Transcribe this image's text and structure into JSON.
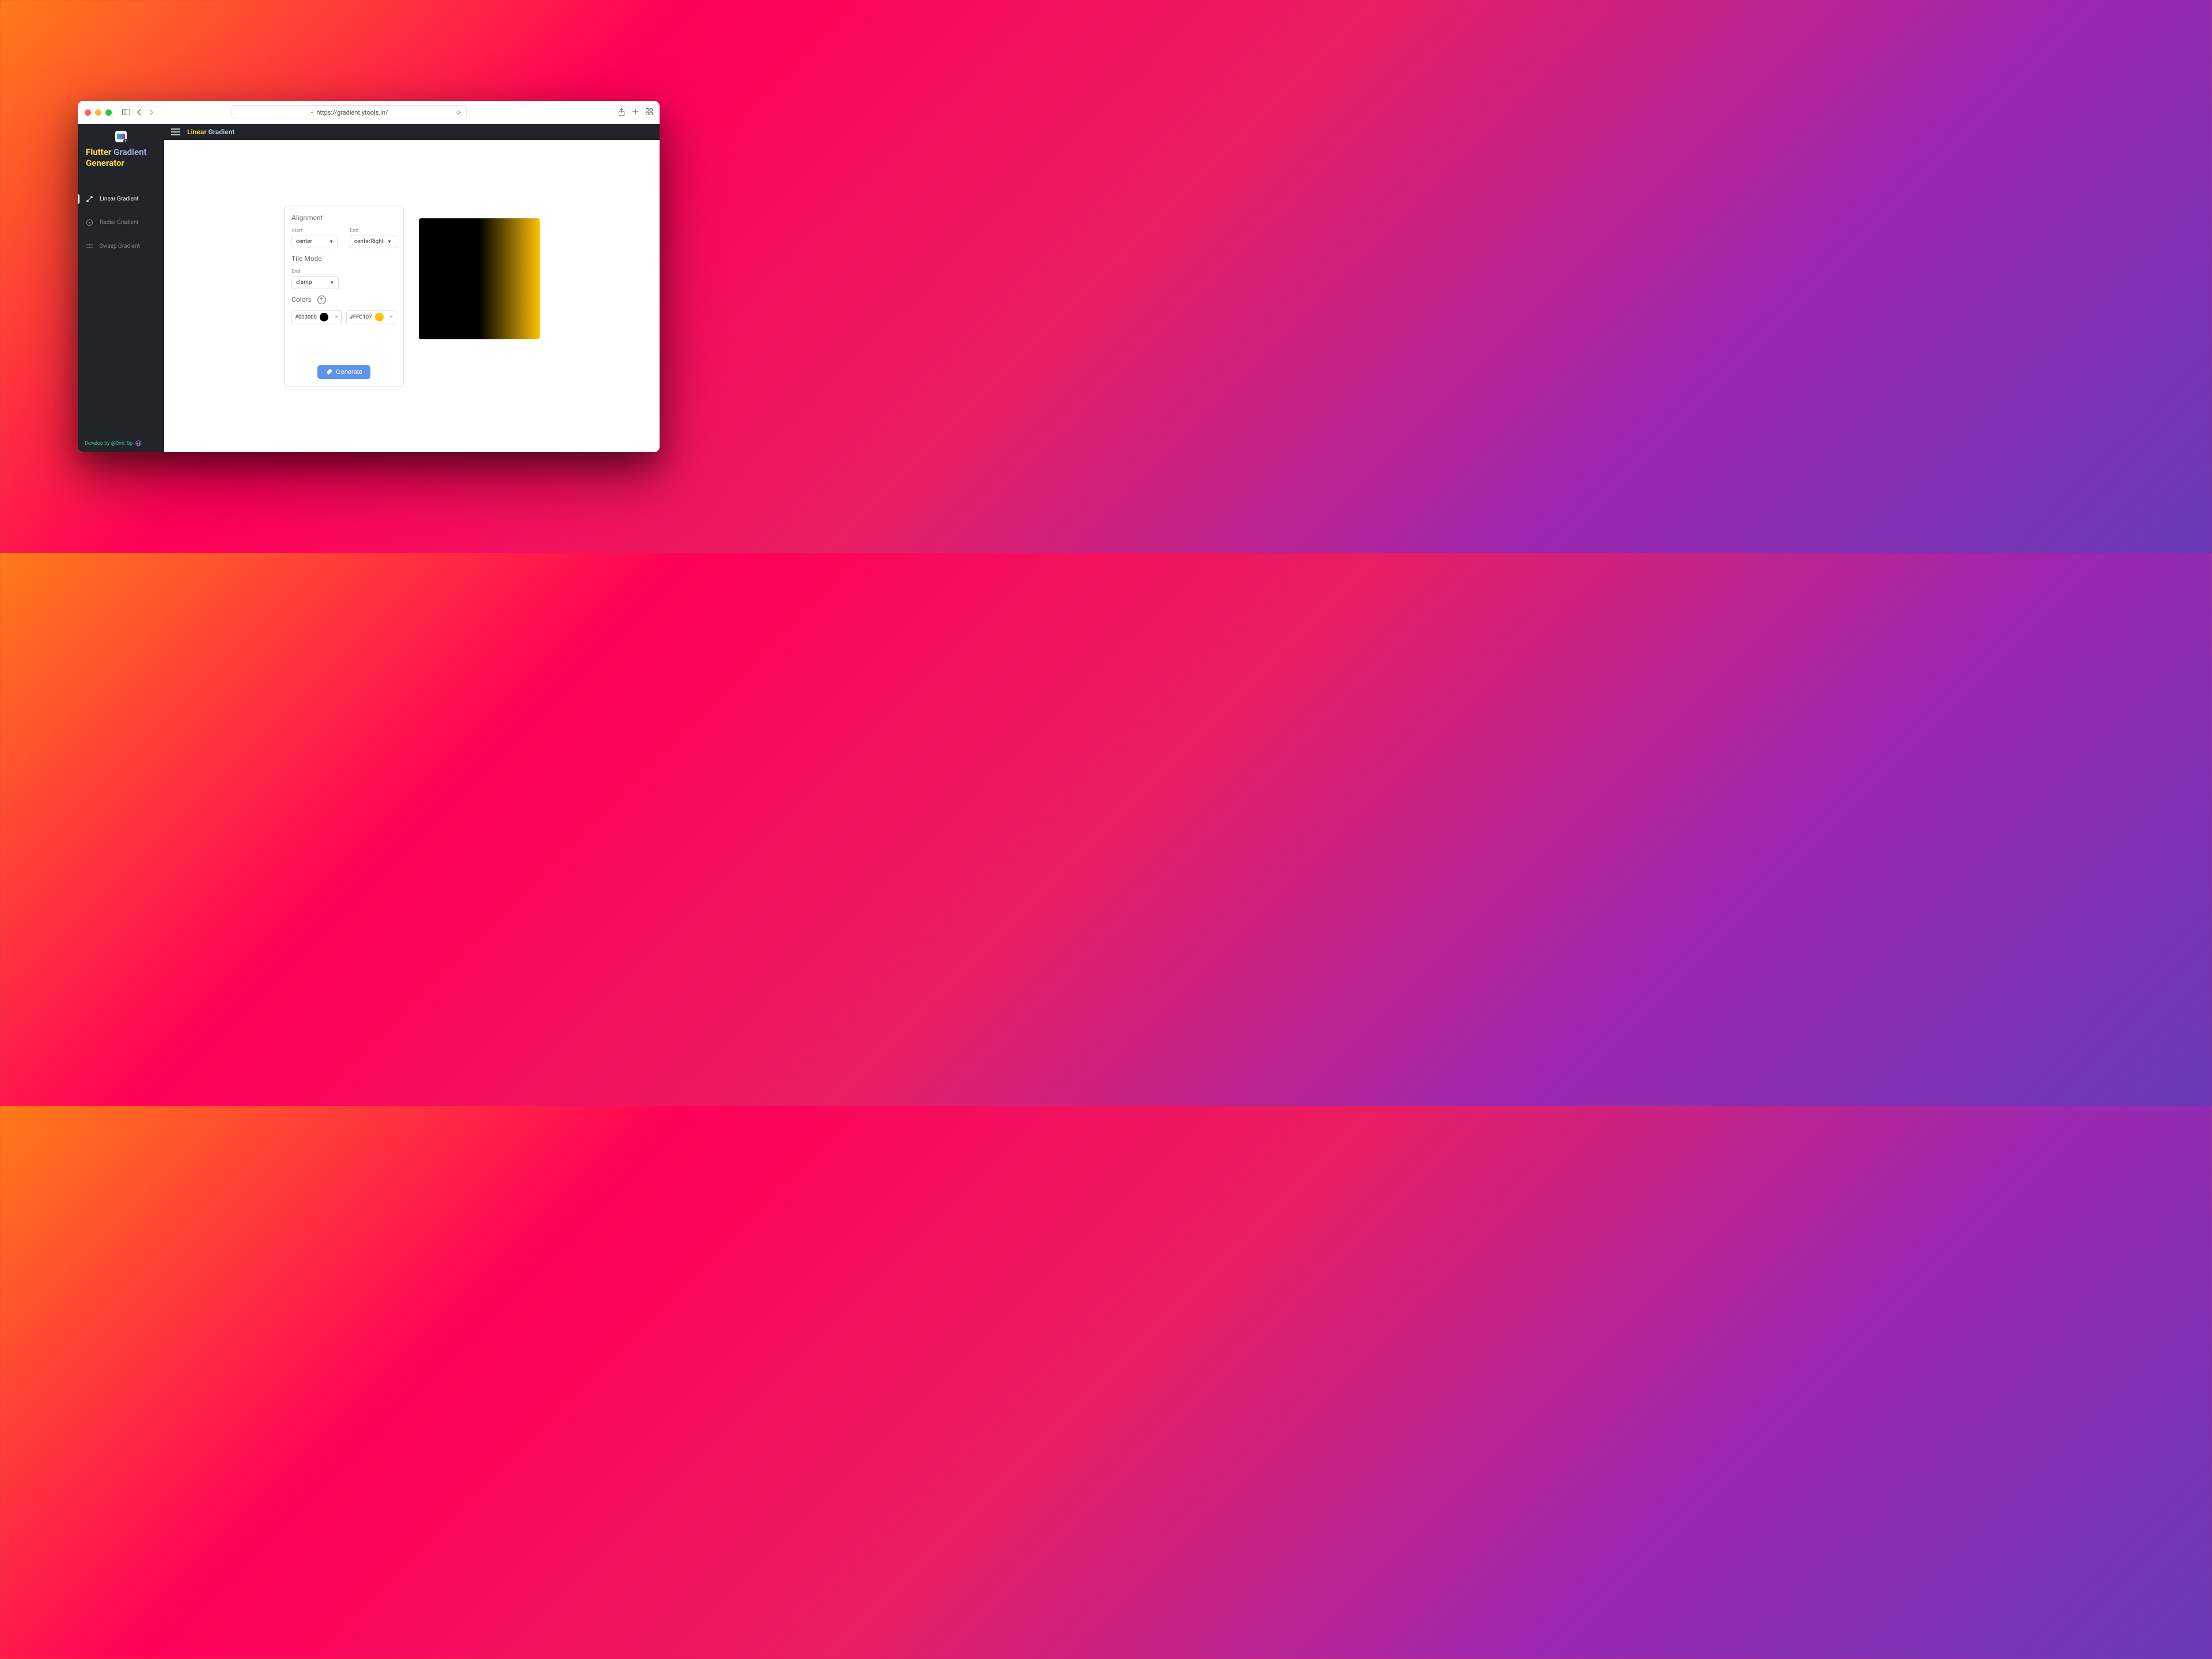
{
  "browser": {
    "url": "https://gradient.ytools.in/"
  },
  "app": {
    "title_word_1": "Flutter",
    "title_word_2": "Gradient",
    "title_word_3": "Generator"
  },
  "sidebar": {
    "items": [
      {
        "label": "Linear Gradient",
        "active": true
      },
      {
        "label": "Radial Gradient",
        "active": false
      },
      {
        "label": "Sweep Gradient",
        "active": false
      }
    ],
    "footer_text": "Develop by @0mi_0p"
  },
  "topbar": {
    "title_word_1": "Linear",
    "title_word_2": "Gradient"
  },
  "panel": {
    "alignment_label": "Alignment",
    "alignment_start_label": "Start",
    "alignment_start_value": "center",
    "alignment_end_label": "End",
    "alignment_end_value": "centerRight",
    "tilemode_label": "Tile Mode",
    "tilemode_field_label": "End",
    "tilemode_value": "clamp",
    "colors_label": "Colors",
    "colors": [
      {
        "hex": "#000000"
      },
      {
        "hex": "#FFC107"
      }
    ],
    "generate_label": "Generate"
  }
}
